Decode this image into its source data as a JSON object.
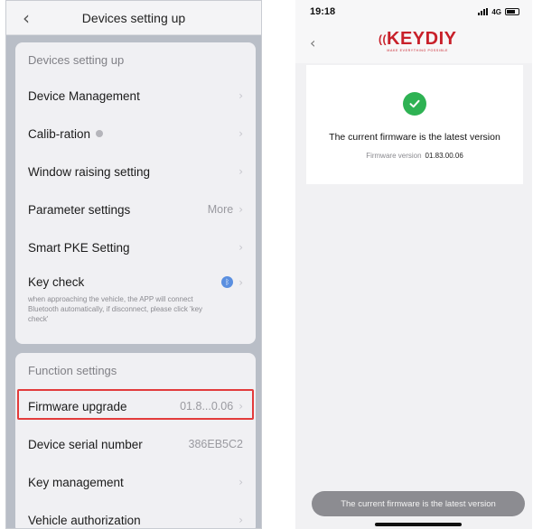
{
  "left": {
    "header": {
      "back_icon": "chevron-left-icon",
      "title": "Devices setting up"
    },
    "section1": {
      "title": "Devices setting up",
      "items": [
        {
          "label": "Device Management"
        },
        {
          "label": "Calib-ration"
        },
        {
          "label": "Window raising setting"
        },
        {
          "label": "Parameter settings",
          "value": "More"
        },
        {
          "label": "Smart PKE Setting"
        }
      ],
      "key_check": {
        "label": "Key check",
        "description": "when approaching the vehicle,  the APP will connect Bluetooth automatically, if disconnect, please click 'key check'"
      }
    },
    "section2": {
      "title": "Function settings",
      "items": [
        {
          "label": "Firmware upgrade",
          "value": "01.8...0.06"
        },
        {
          "label": "Device serial number",
          "value": "386EB5C2"
        },
        {
          "label": "Key management"
        },
        {
          "label": "Vehicle authorization"
        }
      ]
    },
    "highlight_color": "#e23b3b"
  },
  "right": {
    "status_bar": {
      "time": "19:18",
      "network": "4G"
    },
    "logo": {
      "text": "KEYDIY",
      "tagline": "MAKE EVERYTHING POSSIBLE",
      "color": "#c8202a"
    },
    "result": {
      "title": "The current firmware is the latest version",
      "fw_label": "Firmware version",
      "fw_value": "01.83.00.06",
      "success_color": "#2eb253"
    },
    "toast": "The current firmware is the latest version"
  }
}
